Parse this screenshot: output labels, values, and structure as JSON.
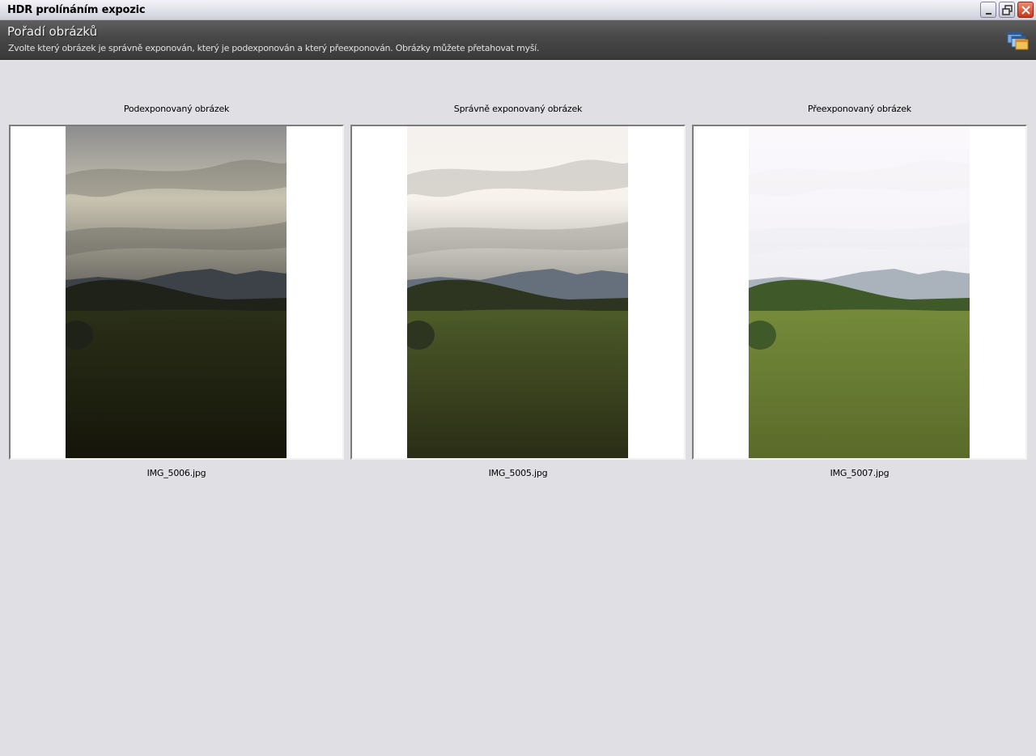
{
  "window": {
    "title": "HDR prolínáním expozic"
  },
  "header": {
    "title": "Pořadí obrázků",
    "subtitle": "Zvolte který obrázek je správně exponován, který je podexponován a který přeexponován. Obrázky můžete přetahovat myší.",
    "icon": "windows-stack-icon"
  },
  "images": [
    {
      "caption": "Podexponovaný obrázek",
      "filename": "IMG_5006.jpg",
      "exposure": "under",
      "colors": {
        "sky_top": "#8d8d8f",
        "sky_mid": "#c8c3b0",
        "sky_low": "#6a6862",
        "hills": "#3d4248",
        "treeline": "#1e2218",
        "grass_top": "#2a2f17",
        "grass_bottom": "#15150a"
      }
    },
    {
      "caption": "Správně exponovaný obrázek",
      "filename": "IMG_5005.jpg",
      "exposure": "normal",
      "colors": {
        "sky_top": "#f4f1ef",
        "sky_mid": "#f7f3ec",
        "sky_low": "#9f9d97",
        "hills": "#66707c",
        "treeline": "#2d3520",
        "grass_top": "#4c5a28",
        "grass_bottom": "#2a2d16"
      }
    },
    {
      "caption": "Přeexponovaný obrázek",
      "filename": "IMG_5007.jpg",
      "exposure": "over",
      "colors": {
        "sky_top": "#fbf8fc",
        "sky_mid": "#f9f6fb",
        "sky_low": "#eeeef2",
        "hills": "#aab3bb",
        "treeline": "#3f5a28",
        "grass_top": "#748a3a",
        "grass_bottom": "#5a6a2a"
      }
    }
  ]
}
